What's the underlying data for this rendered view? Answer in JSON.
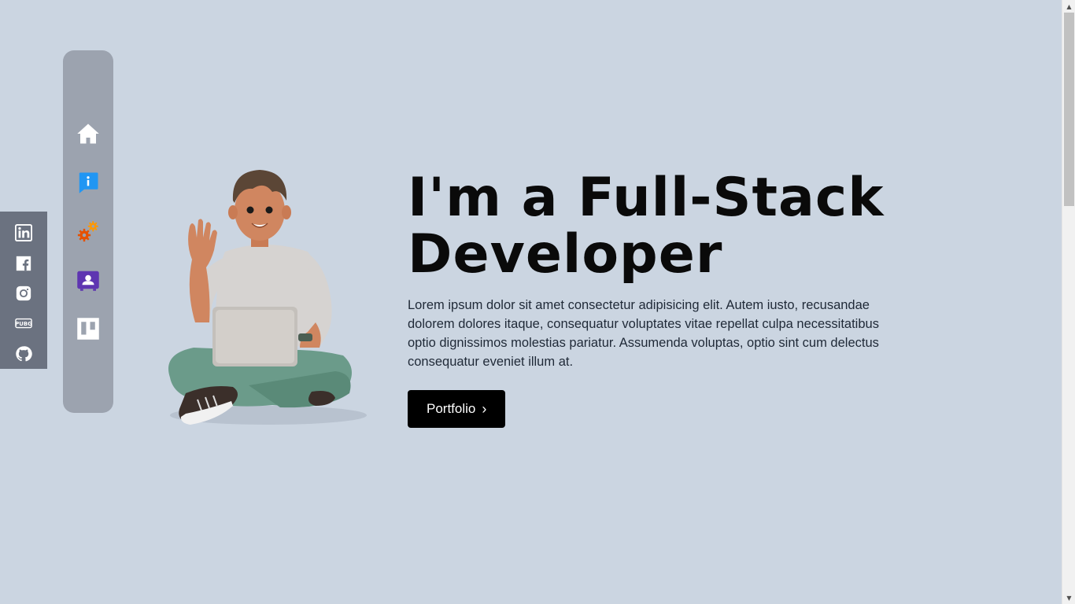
{
  "social": {
    "items": [
      {
        "icon": "linkedin-icon",
        "label": "LinkedIn"
      },
      {
        "icon": "facebook-icon",
        "label": "Facebook"
      },
      {
        "icon": "instagram-icon",
        "label": "Instagram"
      },
      {
        "icon": "pubg-icon",
        "label": "PUBG"
      },
      {
        "icon": "github-icon",
        "label": "GitHub"
      }
    ]
  },
  "nav": {
    "items": [
      {
        "icon": "home-icon",
        "color": "#ffffff"
      },
      {
        "icon": "info-icon",
        "color": "#2196f3"
      },
      {
        "icon": "gears-icon",
        "color": "#e65100"
      },
      {
        "icon": "contact-icon",
        "color": "#5e35b1"
      },
      {
        "icon": "trello-icon",
        "color": "#ffffff"
      }
    ]
  },
  "hero": {
    "title_line1": "I'm a Full-Stack",
    "title_line2": "Developer",
    "description": "Lorem ipsum dolor sit amet consectetur adipisicing elit. Autem iusto, recusandae dolorem dolores itaque, consequatur voluptates vitae repellat culpa necessitatibus optio dignissimos molestias pariatur. Assumenda voluptas, optio sint cum delectus consequatur eveniet illum at.",
    "button_label": "Portfolio",
    "button_chevron": "›"
  },
  "colors": {
    "background": "#cbd5e1",
    "nav_bg": "#9ca3af",
    "social_bg": "#6b7280",
    "button_bg": "#000000"
  }
}
